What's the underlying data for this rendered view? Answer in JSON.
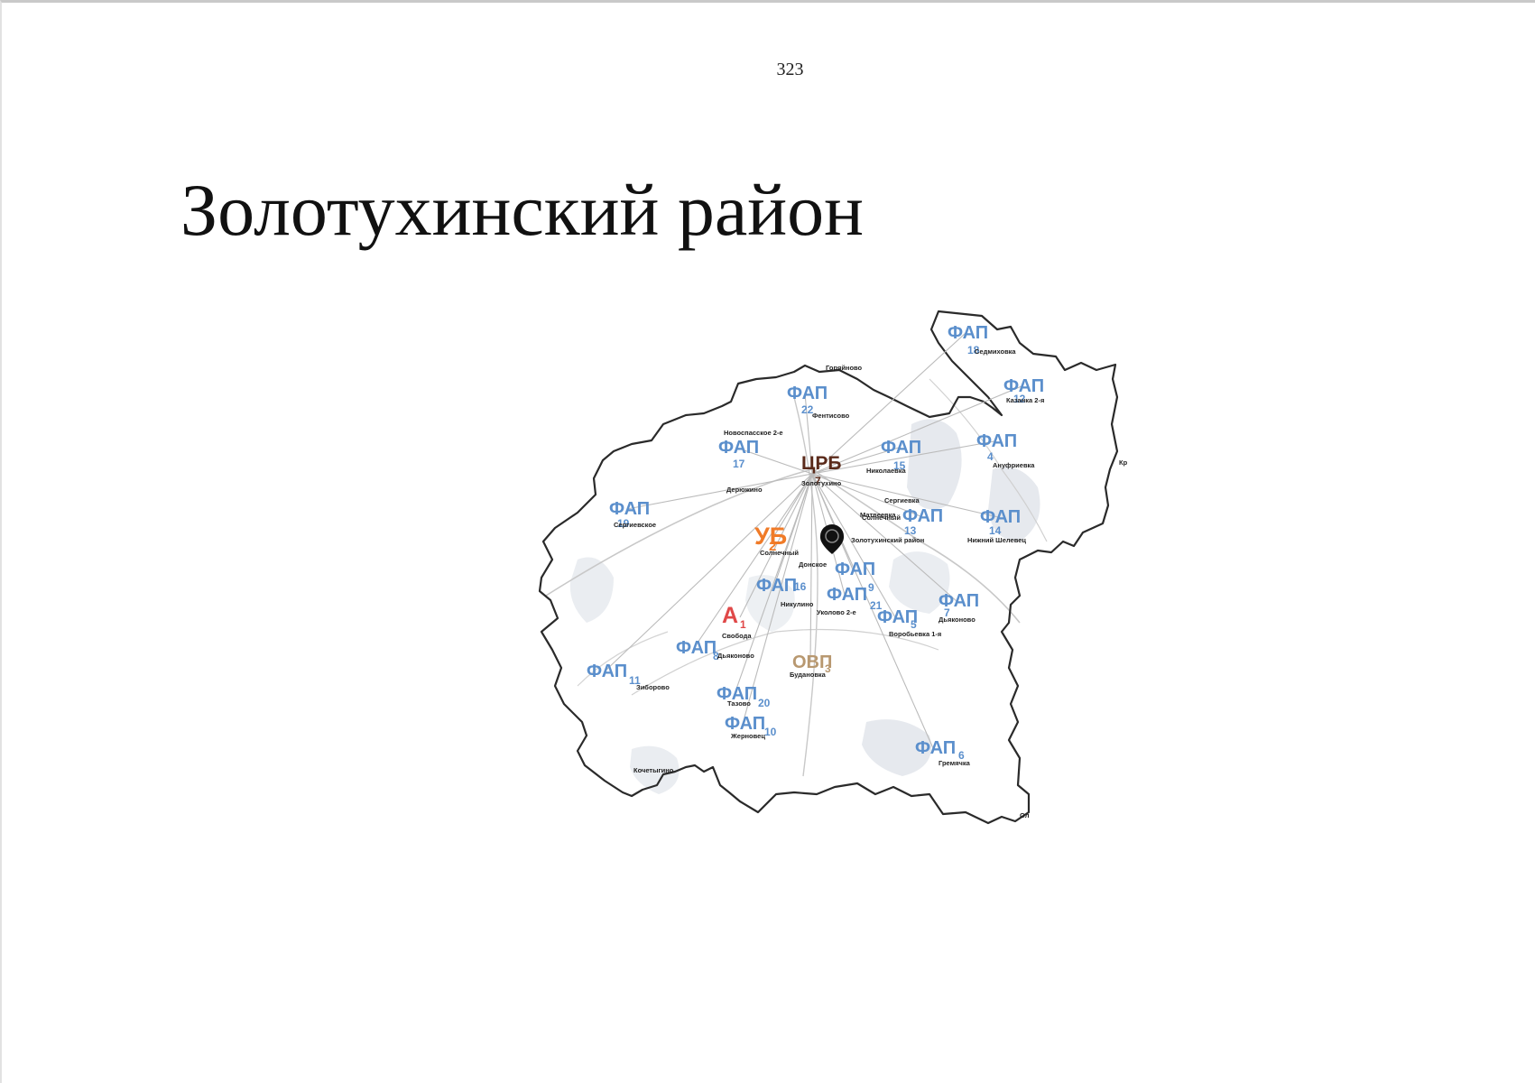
{
  "page": {
    "number": "323",
    "title": "Золотухинский район"
  },
  "colors": {
    "fap": "#5b8fcc",
    "crb": "#5a2a1a",
    "ub": "#f07b28",
    "a": "#e04848",
    "ovp": "#b89870",
    "border": "#2a2a2a",
    "road": "#c8c8c8",
    "link": "#bbbbbb",
    "forest": "#e6e9ee"
  },
  "map": {
    "facilities": [
      {
        "id": "fap18",
        "abbr": "ФАП",
        "sub": "18",
        "type": "fap",
        "village": "Седмиховка"
      },
      {
        "id": "fap12",
        "abbr": "ФАП",
        "sub": "12",
        "type": "fap",
        "village": "Казанка 2-я"
      },
      {
        "id": "fap22",
        "abbr": "ФАП",
        "sub": "22",
        "type": "fap",
        "village": "Фентисово"
      },
      {
        "id": "fap4",
        "abbr": "ФАП",
        "sub": "4",
        "type": "fap",
        "village": "Ануфриевка"
      },
      {
        "id": "fap17",
        "abbr": "ФАП",
        "sub": "17",
        "type": "fap",
        "village": "Новоспасское 2-е"
      },
      {
        "id": "crb7",
        "abbr": "ЦРБ",
        "sub": "7",
        "type": "crb",
        "village": "Золотухино"
      },
      {
        "id": "fap15",
        "abbr": "ФАП",
        "sub": "15",
        "type": "fap",
        "village": "Николаевка"
      },
      {
        "id": "fap19",
        "abbr": "ФАП",
        "sub": "19",
        "type": "fap",
        "village": "Сергиевское"
      },
      {
        "id": "fap13",
        "abbr": "ФАП",
        "sub": "13",
        "type": "fap",
        "village": "Солнечный"
      },
      {
        "id": "fap14",
        "abbr": "ФАП",
        "sub": "14",
        "type": "fap",
        "village": "Нижний Шелевец"
      },
      {
        "id": "ub2",
        "abbr": "УБ",
        "sub": "2",
        "type": "ub",
        "village": "Солнечный"
      },
      {
        "id": "fap9",
        "abbr": "ФАП",
        "sub": "9",
        "type": "fap",
        "village": "Донское"
      },
      {
        "id": "fap16",
        "abbr": "ФАП",
        "sub": "16",
        "type": "fap",
        "village": "Никулино"
      },
      {
        "id": "fap21",
        "abbr": "ФАП",
        "sub": "21",
        "type": "fap",
        "village": "Уколово 2-е"
      },
      {
        "id": "fap7",
        "abbr": "ФАП",
        "sub": "7",
        "type": "fap",
        "village": "Дьяконово"
      },
      {
        "id": "a1",
        "abbr": "А",
        "sub": "1",
        "type": "a",
        "village": "Свобода"
      },
      {
        "id": "fap5",
        "abbr": "ФАП",
        "sub": "5",
        "type": "fap",
        "village": "Воробьевка 1-я"
      },
      {
        "id": "fap8",
        "abbr": "ФАП",
        "sub": "8",
        "type": "fap",
        "village": "Дьяконово"
      },
      {
        "id": "ovp3",
        "abbr": "ОВП",
        "sub": "3",
        "type": "ovp",
        "village": "Будановка"
      },
      {
        "id": "fap11",
        "abbr": "ФАП",
        "sub": "11",
        "type": "fap",
        "village": "Зиборово"
      },
      {
        "id": "fap20",
        "abbr": "ФАП",
        "sub": "20",
        "type": "fap",
        "village": "Тазово"
      },
      {
        "id": "fap10",
        "abbr": "ФАП",
        "sub": "10",
        "type": "fap",
        "village": "Жерновец"
      },
      {
        "id": "fap6",
        "abbr": "ФАП",
        "sub": "6",
        "type": "fap",
        "village": "Гремячка"
      }
    ],
    "places": [
      {
        "id": "gorjainovo",
        "name": "Горяйново"
      },
      {
        "id": "derjugino",
        "name": "Дерюжино"
      },
      {
        "id": "sergievka",
        "name": "Сергиевка"
      },
      {
        "id": "materinovo",
        "name": "Матвеевка"
      },
      {
        "id": "district-marker",
        "name": "Золотухинский район"
      },
      {
        "id": "kr-edge",
        "name": "Кр"
      },
      {
        "id": "ol-edge",
        "name": "Ол"
      },
      {
        "id": "sp-edge",
        "name": "Кочетыгино"
      }
    ]
  }
}
